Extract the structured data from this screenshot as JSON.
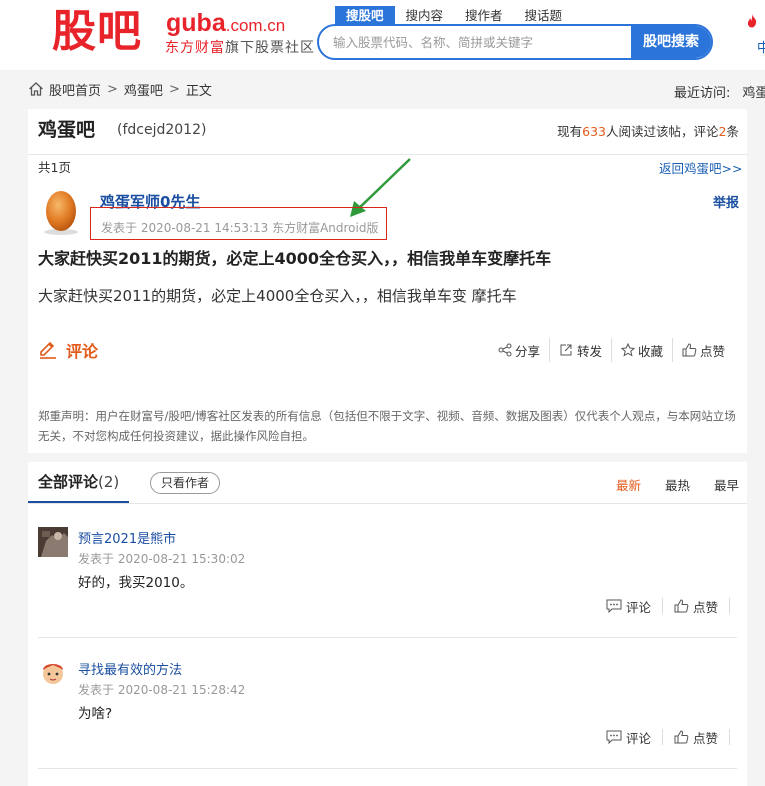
{
  "header": {
    "logo_cn": "股吧",
    "logo_domain": "guba",
    "logo_tld": ".com.cn",
    "logo_sub_brand": "东方财富",
    "logo_sub_rest": "旗下股票社区",
    "search_tabs": [
      "搜股吧",
      "搜内容",
      "搜作者",
      "搜话题"
    ],
    "search_placeholder": "输入股票代码、名称、简拼或关键字",
    "search_button": "股吧搜索",
    "hot_text": "中"
  },
  "breadcrumb": {
    "items": [
      "股吧首页",
      "鸡蛋吧",
      "正文"
    ],
    "recent_label": "最近访问:",
    "recent_link": "鸡蛋"
  },
  "bar": {
    "name": "鸡蛋吧",
    "code": "(fdcejd2012)",
    "stats_prefix": "现有",
    "readers": "633",
    "stats_mid": "人阅读过该帖，评论",
    "comments": "2",
    "stats_suffix": "条",
    "pages": "共1页",
    "back_link": "返回鸡蛋吧>>"
  },
  "post": {
    "author": "鸡蛋军师0先生",
    "report": "举报",
    "meta": "发表于 2020-08-21 14:53:13 东方财富Android版",
    "title": "大家赶快买2011的期货，必定上4000全仓买入，，相信我单车变摩托车",
    "body": "大家赶快买2011的期货，必定上4000全仓买入，，相信我单车变 摩托车",
    "comment_label": "评论",
    "actions": [
      "分享",
      "转发",
      "收藏",
      "点赞"
    ],
    "disclaimer": "郑重声明：用户在财富号/股吧/博客社区发表的所有信息（包括但不限于文字、视频、音频、数据及图表）仅代表个人观点，与本网站立场无关，不对您构成任何投资建议，据此操作风险自担。"
  },
  "comments_section": {
    "tab_label": "全部评论",
    "tab_count": "(2)",
    "author_only": "只看作者",
    "sorts": [
      "最新",
      "最热",
      "最早"
    ],
    "items": [
      {
        "user": "预言2021是熊市",
        "time": "发表于 2020-08-21 15:30:02",
        "text": "好的，我买2010。",
        "reply": "评论",
        "like": "点赞"
      },
      {
        "user": "寻找最有效的方法",
        "time": "发表于 2020-08-21 15:28:42",
        "text": "为啥?",
        "reply": "评论",
        "like": "点赞"
      }
    ]
  },
  "colors": {
    "brand_red": "#e8232a",
    "link_blue": "#1a4ea1",
    "accent_orange": "#e35b1c",
    "search_blue": "#2b74d9"
  }
}
